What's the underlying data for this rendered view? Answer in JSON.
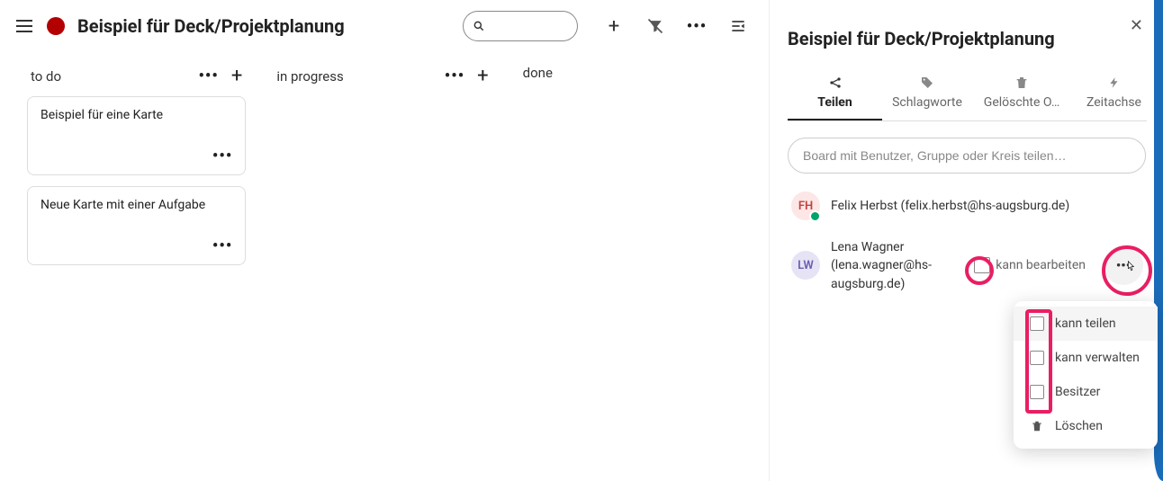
{
  "header": {
    "board_title": "Beispiel für Deck/Projektplanung"
  },
  "columns": [
    {
      "title": "to do",
      "cards": [
        {
          "text": "Beispiel für eine Karte"
        },
        {
          "text": "Neue Karte mit einer Aufgabe"
        }
      ]
    },
    {
      "title": "in progress",
      "cards": []
    },
    {
      "title": "done",
      "cards": [],
      "hide_actions": true
    }
  ],
  "side": {
    "title": "Beispiel für Deck/Projektplanung",
    "tabs": [
      {
        "label": "Teilen",
        "active": true,
        "icon": "share"
      },
      {
        "label": "Schlagworte",
        "icon": "tag"
      },
      {
        "label": "Gelöschte O…",
        "icon": "trash"
      },
      {
        "label": "Zeitachse",
        "icon": "bolt"
      }
    ],
    "share_placeholder": "Board mit Benutzer, Gruppe oder Kreis teilen…",
    "shares": [
      {
        "initials": "FH",
        "name": "Felix Herbst (felix.herbst@hs-augsburg.de)",
        "cls": "fh"
      },
      {
        "initials": "LW",
        "name": "Lena Wagner (lena.wagner@hs-augsburg.de)",
        "cls": "lw",
        "editable": true
      }
    ],
    "edit_label": "kann bearbeiten",
    "popover": [
      {
        "label": "kann teilen",
        "type": "check"
      },
      {
        "label": "kann verwalten",
        "type": "check"
      },
      {
        "label": "Besitzer",
        "type": "check"
      },
      {
        "label": "Löschen",
        "type": "delete"
      }
    ]
  }
}
